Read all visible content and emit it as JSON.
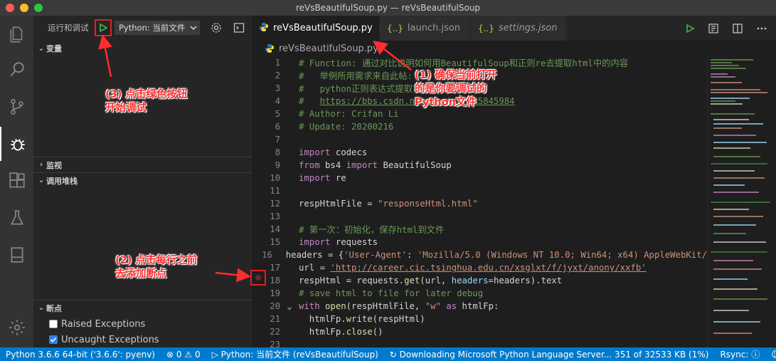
{
  "window": {
    "title": "reVsBeautifulSoup.py — reVsBeautifulSoup"
  },
  "traffic": {
    "close": "#fe5f57",
    "minimize": "#febc2e",
    "zoom": "#28c840"
  },
  "activity": [
    "explorer-icon",
    "search-icon",
    "source-control-icon",
    "debug-icon",
    "extensions-icon",
    "test-flask-icon",
    "bookmark-icon",
    "settings-gear-icon"
  ],
  "sidebar": {
    "toolbar_title": "运行和调试",
    "config_value": "Python: 当前文件",
    "sections": {
      "variables": "变量",
      "watch": "监视",
      "call_stack": "调用堆栈",
      "breakpoints": "断点"
    },
    "breakpoint_options": [
      {
        "label": "Raised Exceptions",
        "checked": false
      },
      {
        "label": "Uncaught Exceptions",
        "checked": true
      }
    ]
  },
  "tabs": [
    {
      "label": "reVsBeautifulSoup.py",
      "active": true
    },
    {
      "label": "launch.json",
      "active": false
    },
    {
      "label": "settings.json",
      "active": false
    }
  ],
  "breadcrumb": "reVsBeautifulSoup.py",
  "code_lines": [
    "1",
    "2",
    "3",
    "4",
    "5",
    "6",
    "7",
    "8",
    "9",
    "10",
    "11",
    "12",
    "13",
    "14",
    "15",
    "16",
    "17",
    "18",
    "19",
    "20",
    "21",
    "22",
    "23"
  ],
  "code": {
    "l1": "# Function: 通过对比说明如何用BeautifulSoup和正则re去提取html中的内容",
    "l2": "#   举例所用需求来自此帖:",
    "l3": "#   python正则表达式提取字",
    "l4a": "#   ",
    "l4b": "https://bbs.csdn.net/topics/395845984",
    "l5": "# Author: Crifan Li",
    "l6": "# Update: 20200216",
    "l8k": "import",
    "l8t": " codecs",
    "l9k1": "from",
    "l9t1": " bs4 ",
    "l9k2": "import",
    "l9t2": " BeautifulSoup",
    "l10k": "import",
    "l10t": " re",
    "l12a": "respHtmlFile = ",
    "l12s": "\"responseHtml.html\"",
    "l14": "# 第一次：初始化，保存html到文件",
    "l15k": "import",
    "l15t": " requests",
    "l16a": "headers = {",
    "l16s1": "'User-Agent'",
    "l16b": ": ",
    "l16s2": "'Mozilla/5.0 (Windows NT 10.0; Win64; x64) AppleWebKit/",
    "l17a": "url = ",
    "l17s": "'http://career.cic.tsinghua.edu.cn/xsglxt/f/jyxt/anony/xxfb'",
    "l18a": "respHtml = requests.",
    "l18f": "get",
    "l18b": "(url, ",
    "l18v": "headers",
    "l18c": "=headers).text",
    "l19": "# save html to file for later debug",
    "l20k": "with",
    "l20f": " open",
    "l20a": "(respHtmlFile, ",
    "l20s": "\"w\"",
    "l20k2": " as",
    "l20b": " htmlFp:",
    "l21a": "  htmlFp.",
    "l21f": "write",
    "l21b": "(respHtml)",
    "l22a": "  htmlFp.",
    "l22f": "close",
    "l22b": "()"
  },
  "annotations": {
    "a1": "(1) 确保当前打开\n的是你要调试的\nPython文件",
    "a2": "(2) 点击每行之前\n去添加断点",
    "a3": "(3) 点击绿色按钮\n开始调试"
  },
  "status": {
    "python": "Python 3.6.6 64-bit ('3.6.6': pyenv)",
    "errors": "0",
    "warnings": "0",
    "debug_config": "Python: 当前文件 (reVsBeautifulSoup)",
    "download": "Downloading Microsoft Python Language Server... 351 of 32533 KB (1%)",
    "rsync": "Rsync:"
  },
  "colors": {
    "accent": "#007acc",
    "annotation": "#ff2d2d",
    "play_green": "#3fb950"
  }
}
